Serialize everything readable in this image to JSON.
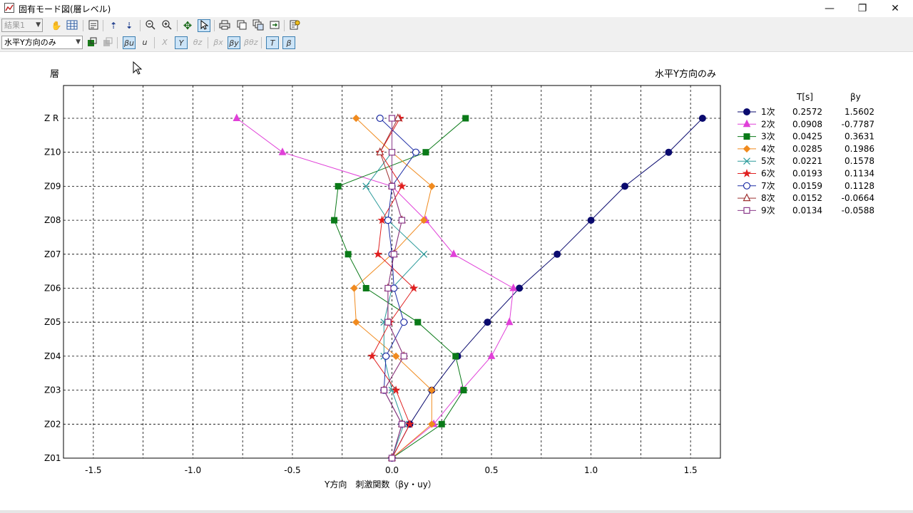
{
  "window": {
    "title": "固有モード図(層レベル)",
    "minimize_glyph": "—",
    "maximize_glyph": "❐",
    "close_glyph": "✕"
  },
  "toolbar1": {
    "result_select": "結果1",
    "icons": [
      "hand-icon",
      "grid-icon",
      "page-icon",
      "arrow-up-icon",
      "arrow-down-icon",
      "zoom-out-icon",
      "zoom-in-icon",
      "move-icon",
      "pointer-icon",
      "print-icon",
      "copy-icon",
      "copy-multi-icon",
      "export-icon",
      "report-icon"
    ]
  },
  "toolbar2": {
    "direction_select": "水平Y方向のみ",
    "buttons": [
      {
        "name": "beta-u",
        "label": "βu",
        "active": true,
        "dim": false
      },
      {
        "name": "u",
        "label": "u",
        "active": false,
        "dim": false
      },
      {
        "name": "x-axis",
        "label": "X",
        "active": false,
        "dim": true
      },
      {
        "name": "y-axis",
        "label": "Y",
        "active": true,
        "dim": false
      },
      {
        "name": "theta-z",
        "label": "θz",
        "active": false,
        "dim": true
      },
      {
        "name": "beta-x",
        "label": "βx",
        "active": false,
        "dim": true
      },
      {
        "name": "beta-y",
        "label": "βy",
        "active": true,
        "dim": false
      },
      {
        "name": "beta-theta-z",
        "label": "βθz",
        "active": false,
        "dim": true
      },
      {
        "name": "text-toggle",
        "label": "T",
        "active": true,
        "dim": false
      },
      {
        "name": "beta-toggle",
        "label": "β",
        "active": true,
        "dim": false
      }
    ]
  },
  "chart_data": {
    "type": "line",
    "title": "水平Y方向のみ",
    "ylabel": "層",
    "xlabel": "Y方向　刺激関数（βy・uy）",
    "xlim": [
      -1.65,
      1.65
    ],
    "xticks": [
      -1.5,
      -1.0,
      -0.5,
      0.0,
      0.5,
      1.0,
      1.5
    ],
    "xtick_labels": [
      "-1.5",
      "-1.0",
      "-0.5",
      "0.0",
      "0.5",
      "1.0",
      "1.5"
    ],
    "categories": [
      "Z01",
      "Z02",
      "Z03",
      "Z04",
      "Z05",
      "Z06",
      "Z07",
      "Z08",
      "Z09",
      "Z10",
      "Z R"
    ],
    "grid": true,
    "legend_position": "right",
    "legend_header": {
      "period": "T[s]",
      "beta": "βy"
    },
    "series": [
      {
        "name": "1次",
        "period": "0.2572",
        "beta": "1.5602",
        "color": "#0a0a6e",
        "marker": "circle",
        "values": [
          0,
          0.09,
          0.2,
          0.33,
          0.48,
          0.64,
          0.83,
          1.0,
          1.17,
          1.39,
          1.56
        ]
      },
      {
        "name": "2次",
        "period": "0.0908",
        "beta": "-0.7787",
        "color": "#e040d8",
        "marker": "triangle",
        "values": [
          0,
          0.21,
          0.35,
          0.5,
          0.59,
          0.61,
          0.31,
          0.17,
          0.0,
          -0.55,
          -0.78
        ]
      },
      {
        "name": "3次",
        "period": "0.0425",
        "beta": "0.3631",
        "color": "#0a7a18",
        "marker": "square",
        "values": [
          0,
          0.25,
          0.36,
          0.32,
          0.13,
          -0.13,
          -0.22,
          -0.29,
          -0.27,
          0.17,
          0.37
        ]
      },
      {
        "name": "4次",
        "period": "0.0285",
        "beta": "0.1986",
        "color": "#f08a1e",
        "marker": "diamond",
        "values": [
          0,
          0.2,
          0.2,
          0.02,
          -0.18,
          -0.19,
          0.0,
          0.16,
          0.2,
          0.0,
          -0.18
        ]
      },
      {
        "name": "5次",
        "period": "0.0221",
        "beta": "0.1578",
        "color": "#2a9a9a",
        "marker": "x",
        "values": [
          0,
          0.06,
          0.0,
          -0.04,
          -0.04,
          0.0,
          0.16,
          -0.02,
          -0.13,
          0.0,
          0.0
        ]
      },
      {
        "name": "6次",
        "period": "0.0193",
        "beta": "0.1134",
        "color": "#e02020",
        "marker": "star",
        "values": [
          0,
          0.09,
          0.02,
          -0.1,
          -0.01,
          0.11,
          -0.07,
          -0.05,
          0.05,
          -0.06,
          0.04
        ]
      },
      {
        "name": "7次",
        "period": "0.0159",
        "beta": "0.1128",
        "color": "#1e2ea6",
        "marker": "circle-open",
        "values": [
          0,
          0.05,
          -0.04,
          -0.03,
          0.06,
          0.01,
          0.0,
          -0.02,
          0.0,
          0.12,
          -0.06
        ]
      },
      {
        "name": "8次",
        "period": "0.0152",
        "beta": "-0.0664",
        "color": "#9e3030",
        "marker": "triangle-open",
        "values": [
          0,
          0.05,
          -0.04,
          0.06,
          -0.02,
          -0.02,
          0.01,
          0.05,
          0.0,
          -0.06,
          0.03
        ]
      },
      {
        "name": "9次",
        "period": "0.0134",
        "beta": "-0.0588",
        "color": "#8a3a8a",
        "marker": "square-open",
        "values": [
          0,
          0.05,
          -0.04,
          0.06,
          -0.02,
          -0.02,
          0.01,
          0.05,
          0.0,
          0.0,
          0.0
        ]
      }
    ]
  }
}
